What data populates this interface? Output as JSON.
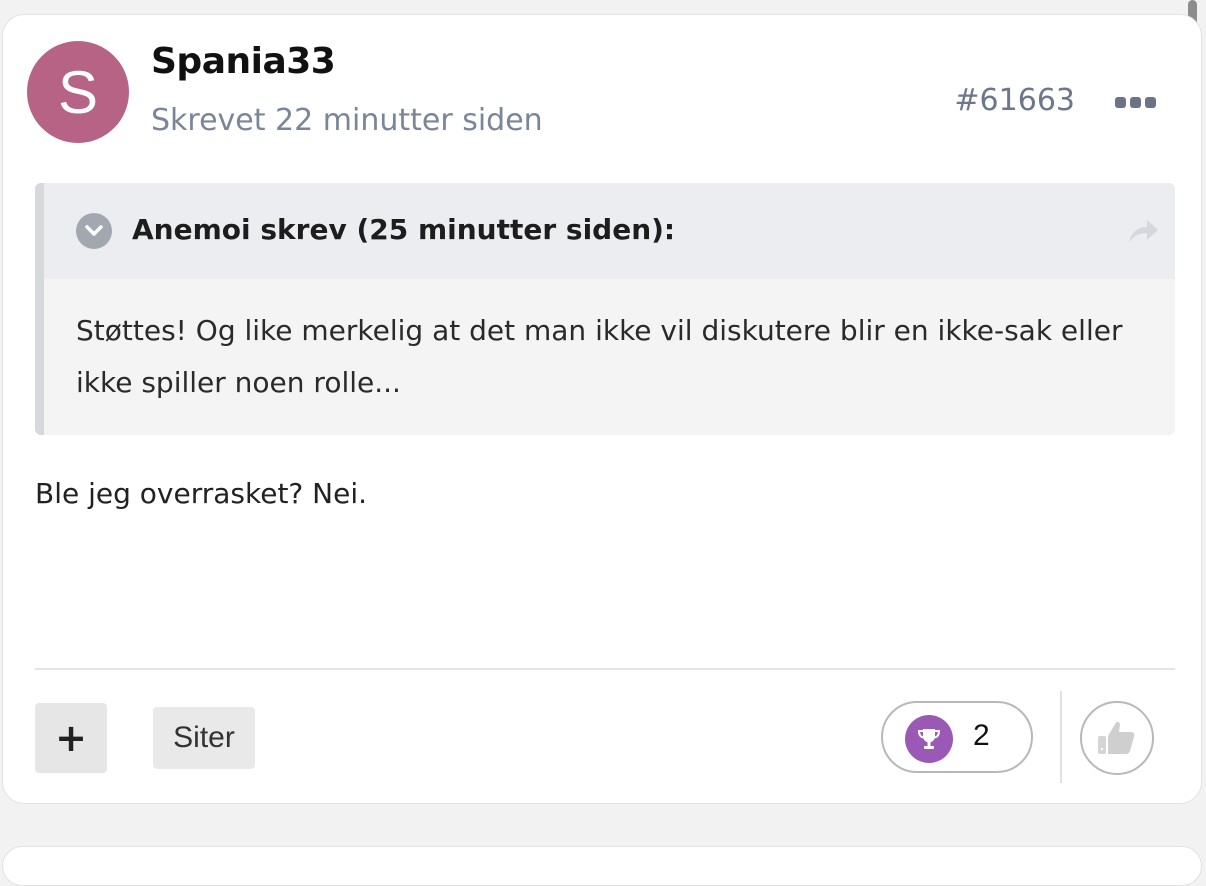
{
  "post": {
    "avatar_letter": "S",
    "author": "Spania33",
    "meta": "Skrevet 22 minutter siden",
    "post_id": "#61663",
    "quote": {
      "title": "Anemoi skrev (25 minutter siden):",
      "text": "Støttes! Og like merkelig at det man ikke vil diskutere blir en ikke-sak eller ikke spiller noen rolle..."
    },
    "text": "Ble jeg overrasket? Nei."
  },
  "footer": {
    "plus_label": "+",
    "quote_label": "Siter",
    "reaction_count": "2"
  },
  "colors": {
    "avatar": "#b76386",
    "reaction_icon": "#9b59b6"
  }
}
